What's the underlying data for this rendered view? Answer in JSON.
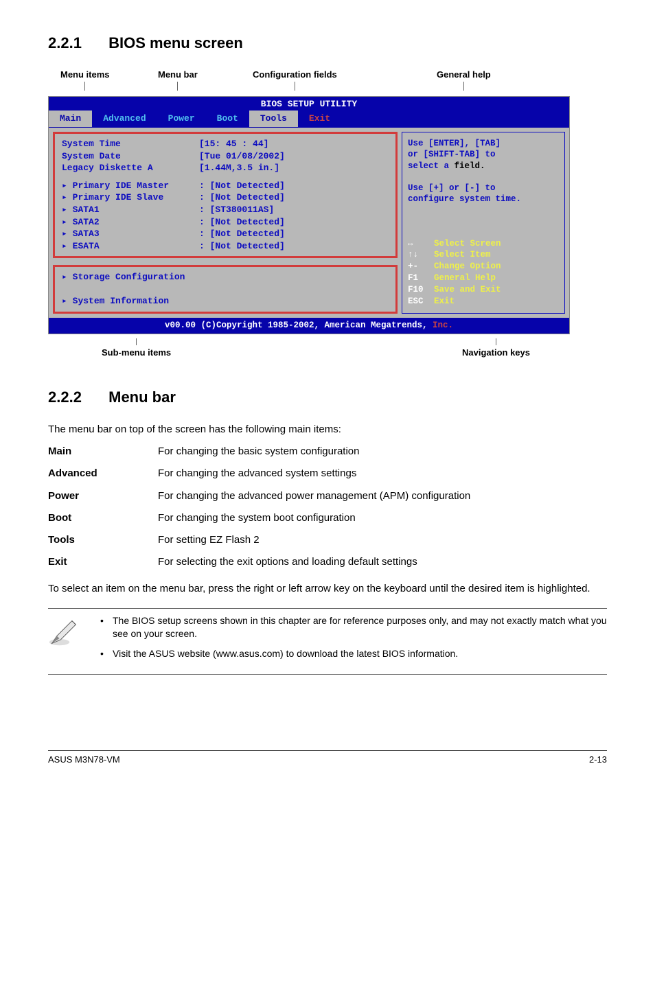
{
  "section1": {
    "num": "2.2.1",
    "title": "BIOS menu screen"
  },
  "top_labels": {
    "menu_items": "Menu items",
    "menu_bar": "Menu bar",
    "config_fields": "Configuration fields",
    "general_help": "General help"
  },
  "bios": {
    "header": "BIOS SETUP UTILITY",
    "tabs": [
      "Main",
      "Advanced",
      "Power",
      "Boot",
      "Tools",
      "Exit"
    ],
    "rows_block1": [
      {
        "label": "System Time",
        "value": "[15: 45 : 44]"
      },
      {
        "label": "System Date",
        "value": "[Tue 01/08/2002]"
      },
      {
        "label": "Legacy Diskette A",
        "value": "[1.44M,3.5 in.]"
      }
    ],
    "rows_block2": [
      {
        "label": "Primary IDE Master",
        "value": "[Not Detected]",
        "arrow": true
      },
      {
        "label": "Primary IDE Slave",
        "value": "[Not Detected]",
        "arrow": true
      },
      {
        "label": "SATA1",
        "value": "[ST380011AS]",
        "arrow": true
      },
      {
        "label": "SATA2",
        "value": "[Not Detected]",
        "arrow": true
      },
      {
        "label": "SATA3",
        "value": "[Not Detected]",
        "arrow": true
      },
      {
        "label": "ESATA",
        "value": "[Not Detected]",
        "arrow": true
      }
    ],
    "rows_block3": [
      {
        "label": "Storage Configuration",
        "arrow": true
      },
      {
        "label": "",
        "arrow": false
      },
      {
        "label": "System Information",
        "arrow": true
      }
    ],
    "help_top": [
      "Use [ENTER], [TAB]",
      "or [SHIFT-TAB] to",
      "select a field.",
      "",
      "Use [+] or [-] to",
      "configure system time."
    ],
    "nav": [
      {
        "key": "↔",
        "desc": "Select Screen"
      },
      {
        "key": "↑↓",
        "desc": "Select Item"
      },
      {
        "key": "+-",
        "desc": "Change Option"
      },
      {
        "key": "F1",
        "desc": "General Help"
      },
      {
        "key": "F10",
        "desc": "Save and Exit"
      },
      {
        "key": "ESC",
        "desc": "Exit"
      }
    ],
    "footer": "v00.00 (C)Copyright 1985-2002, American Megatrends, ",
    "footer_inc": "Inc."
  },
  "bottom_labels": {
    "sub_menu": "Sub-menu items",
    "nav_keys": "Navigation keys"
  },
  "section2": {
    "num": "2.2.2",
    "title": "Menu bar"
  },
  "menu_bar_desc": "The menu bar on top of the screen has the following main items:",
  "definitions": [
    {
      "term": "Main",
      "desc": "For changing the basic system configuration"
    },
    {
      "term": "Advanced",
      "desc": "For changing the advanced system settings"
    },
    {
      "term": "Power",
      "desc": "For changing the advanced power management (APM) configuration"
    },
    {
      "term": "Boot",
      "desc": "For changing the system boot configuration"
    },
    {
      "term": "Tools",
      "desc": "For setting EZ Flash 2"
    },
    {
      "term": "Exit",
      "desc": "For selecting the exit options and loading default settings"
    }
  ],
  "select_text": "To select an item on the menu bar, press the right or left arrow key on the keyboard until the desired item is highlighted.",
  "notes": [
    "The BIOS setup screens shown in this chapter are for reference purposes only, and may not exactly match what you see on your screen.",
    "Visit the ASUS website (www.asus.com) to download the latest BIOS information."
  ],
  "footer": {
    "left": "ASUS M3N78-VM",
    "right": "2-13"
  }
}
